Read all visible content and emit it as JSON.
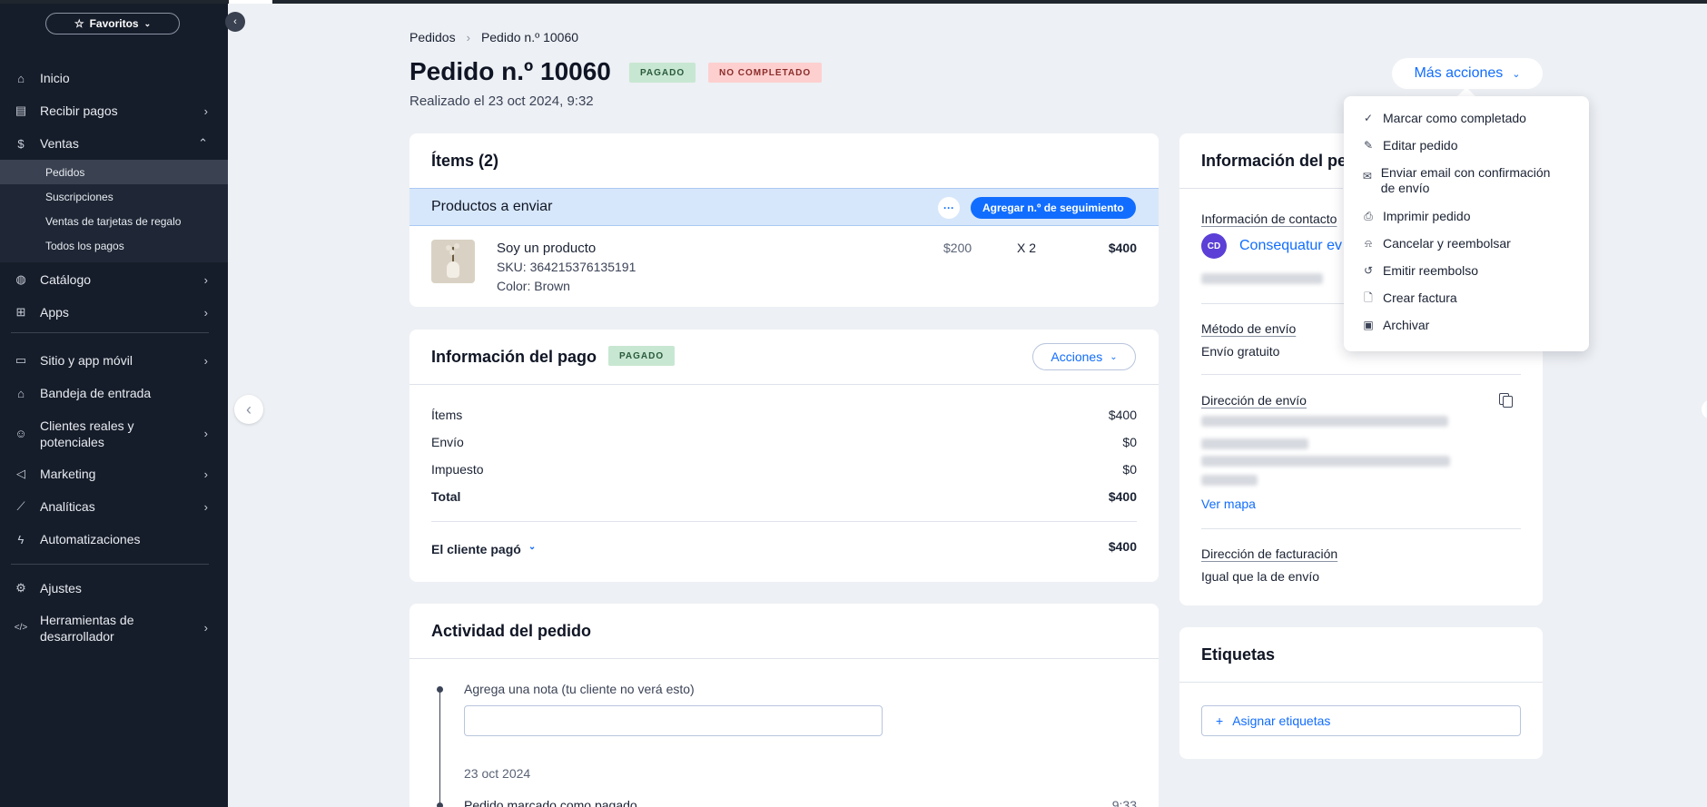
{
  "sidebar": {
    "favorites_label": "Favoritos",
    "items": [
      {
        "label": "Inicio",
        "icon": "home-icon"
      },
      {
        "label": "Recibir pagos",
        "icon": "payments-icon"
      },
      {
        "label": "Ventas",
        "icon": "dollar-icon"
      },
      {
        "label": "Catálogo",
        "icon": "catalog-icon"
      },
      {
        "label": "Apps",
        "icon": "apps-icon"
      },
      {
        "label": "Sitio y app móvil",
        "icon": "site-icon"
      },
      {
        "label": "Bandeja de entrada",
        "icon": "inbox-icon"
      },
      {
        "label": "Clientes reales y potenciales",
        "icon": "contacts-icon"
      },
      {
        "label": "Marketing",
        "icon": "megaphone-icon"
      },
      {
        "label": "Analíticas",
        "icon": "analytics-icon"
      },
      {
        "label": "Automatizaciones",
        "icon": "automation-icon"
      },
      {
        "label": "Ajustes",
        "icon": "gear-icon"
      },
      {
        "label": "Herramientas de desarrollador",
        "icon": "code-icon"
      }
    ],
    "sales_sub": [
      "Pedidos",
      "Suscripciones",
      "Ventas de tarjetas de regalo",
      "Todos los pagos"
    ]
  },
  "breadcrumb": {
    "parent": "Pedidos",
    "current": "Pedido n.º 10060"
  },
  "header": {
    "title": "Pedido n.º 10060",
    "badge_paid": "PAGADO",
    "badge_status": "NO COMPLETADO",
    "subtitle": "Realizado el 23 oct 2024, 9:32",
    "more_actions": "Más acciones"
  },
  "more_menu": [
    "Marcar como completado",
    "Editar pedido",
    "Enviar email con confirmación de envío",
    "Imprimir pedido",
    "Cancelar y reembolsar",
    "Emitir reembolso",
    "Crear factura",
    "Archivar"
  ],
  "items_card": {
    "title": "Ítems (2)",
    "ship_label": "Productos a enviar",
    "track_button": "Agregar n.º de seguimiento",
    "product": {
      "name": "Soy un producto",
      "sku": "SKU: 364215376135191",
      "color": "Color: Brown",
      "price": "$200",
      "qty": "X 2",
      "total": "$400"
    }
  },
  "payment_card": {
    "title": "Información del pago",
    "badge": "PAGADO",
    "actions_button": "Acciones",
    "rows": [
      {
        "label": "Ítems",
        "value": "$400"
      },
      {
        "label": "Envío",
        "value": "$0"
      },
      {
        "label": "Impuesto",
        "value": "$0"
      },
      {
        "label": "Total",
        "value": "$400"
      }
    ],
    "customer_paid_label": "El cliente pagó",
    "customer_paid_value": "$400"
  },
  "activity_card": {
    "title": "Actividad del pedido",
    "note_label": "Agrega una nota (tu cliente no verá esto)",
    "date": "23 oct 2024",
    "event": "Pedido marcado como pagado",
    "event_time": "9:33"
  },
  "order_info": {
    "title": "Información del pe",
    "contact_label": "Información de contacto",
    "avatar_initials": "CD",
    "contact_name": "Consequatur ev",
    "shipping_method_label": "Método de envío",
    "shipping_method": "Envío gratuito",
    "shipping_address_label": "Dirección de envío",
    "map_link": "Ver mapa",
    "billing_label": "Dirección de facturación",
    "billing_value": "Igual que la de envío"
  },
  "tags_card": {
    "title": "Etiquetas",
    "assign_button": "Asignar etiquetas"
  },
  "colors": {
    "accent": "#116dff",
    "sidebar": "#161d2a",
    "paid_bg": "#c8e7d2",
    "notdone_bg": "#fdd0cf"
  }
}
